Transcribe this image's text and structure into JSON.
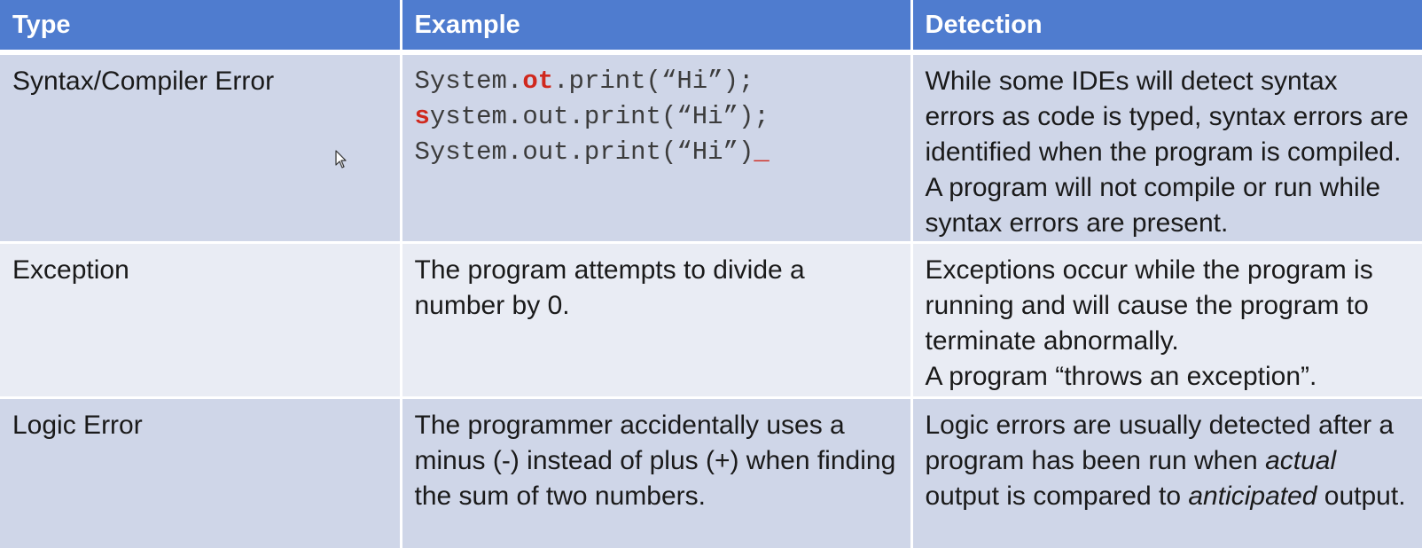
{
  "table": {
    "headers": {
      "type": "Type",
      "example": "Example",
      "detection": "Detection"
    },
    "rows": [
      {
        "type": "Syntax/Compiler Error",
        "code_lines": [
          {
            "pre": "System.",
            "error": "ot",
            "post": ".print(“Hi”);"
          },
          {
            "pre": "",
            "error": "s",
            "post": "ystem.out.print(“Hi”);"
          },
          {
            "pre": "System.out.print(“Hi”)",
            "error": "_",
            "post": ""
          }
        ],
        "detection": "While some IDEs will detect syntax errors as code is typed, syntax errors are identified when the program is compiled.  A program will not compile or run while syntax errors are present."
      },
      {
        "type": "Exception",
        "example": "The program attempts to divide a number by 0.",
        "detection": "Exceptions occur while the program is running and will cause the program to terminate abnormally.",
        "detection_extra": "A program “throws an exception”."
      },
      {
        "type": "Logic Error",
        "example": "The programmer accidentally uses a minus (-) instead of plus (+) when finding the sum of two numbers.",
        "detection": {
          "part1": "Logic errors are usually detected after a program has been run when ",
          "em1": "actual",
          "part2": " output is compared to ",
          "em2": "anticipated",
          "part3": " output."
        }
      }
    ]
  },
  "colors": {
    "header_bg": "#4f7ccf",
    "row_dark": "#cfd6e8",
    "row_light": "#e9ecf4",
    "error_red": "#d0281d"
  },
  "icons": {
    "cursor": "mouse-pointer-icon"
  }
}
